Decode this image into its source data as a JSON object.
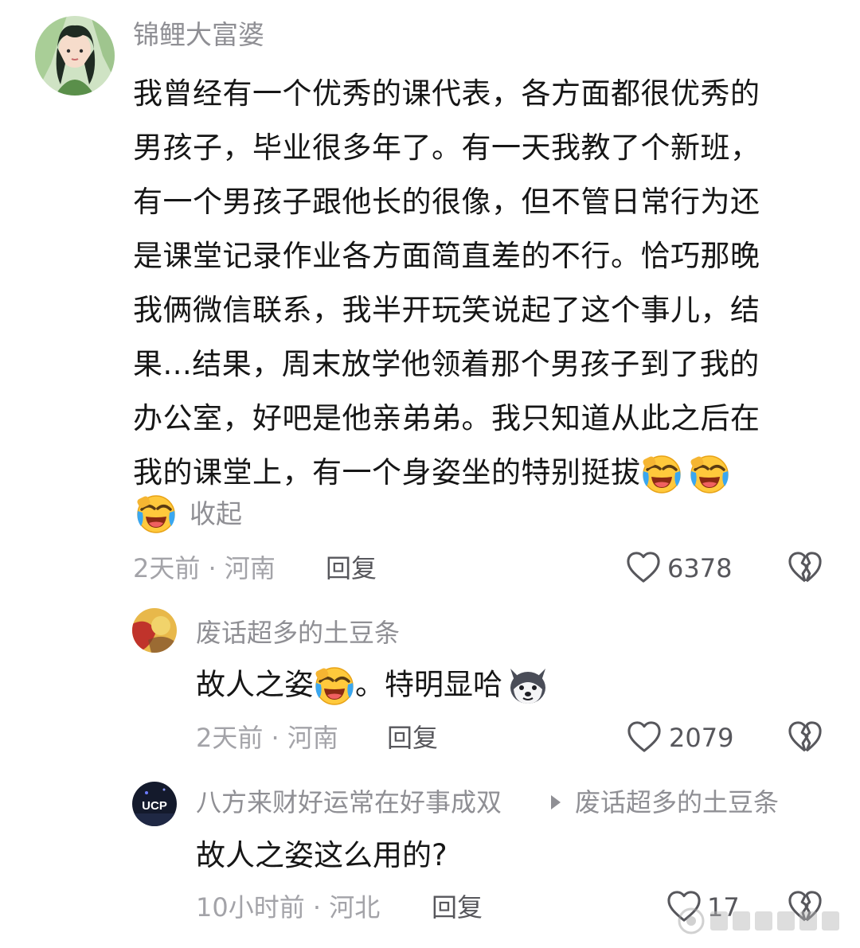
{
  "main_comment": {
    "username": "锦鲤大富婆",
    "lines": [
      "我曾经有一个优秀的课代表，各方面都很优秀的",
      "男孩子，毕业很多年了。有一天我教了个新班，",
      "有一个男孩子跟他长的很像，但不管日常行为还",
      "是课堂记录作业各方面简直差的不行。恰巧那晚",
      "我俩微信联系，我半开玩笑说起了这个事儿，结",
      "果...结果，周末放学他领着那个男孩子到了我的",
      "办公室，好吧是他亲弟弟。我只知道从此之后在",
      "我的课堂上，有一个身姿坐的特别挺拔"
    ],
    "collapse_label": "收起",
    "time": "2天前",
    "location": "河南",
    "reply_label": "回复",
    "likes": "6378",
    "emoji_icon": "laugh-cry-emoji"
  },
  "reply_1": {
    "username": "废话超多的土豆条",
    "text_before": "故人之姿",
    "text_after": "。特明显哈",
    "time": "2天前",
    "location": "河南",
    "reply_label": "回复",
    "likes": "2079",
    "emoji_icons": [
      "laugh-cry-emoji",
      "husky-dog-emoji"
    ]
  },
  "reply_2": {
    "username": "八方来财好运常在好事成双",
    "reply_to": "废话超多的土豆条",
    "text": "故人之姿这么用的?",
    "time": "10小时前",
    "location": "河北",
    "reply_label": "回复",
    "likes": "17",
    "avatar_text": "UCP"
  },
  "separator": "·",
  "colors": {
    "text": "#161616",
    "username": "#8f8f94",
    "meta": "#a3a3a8",
    "background": "#ffffff"
  }
}
